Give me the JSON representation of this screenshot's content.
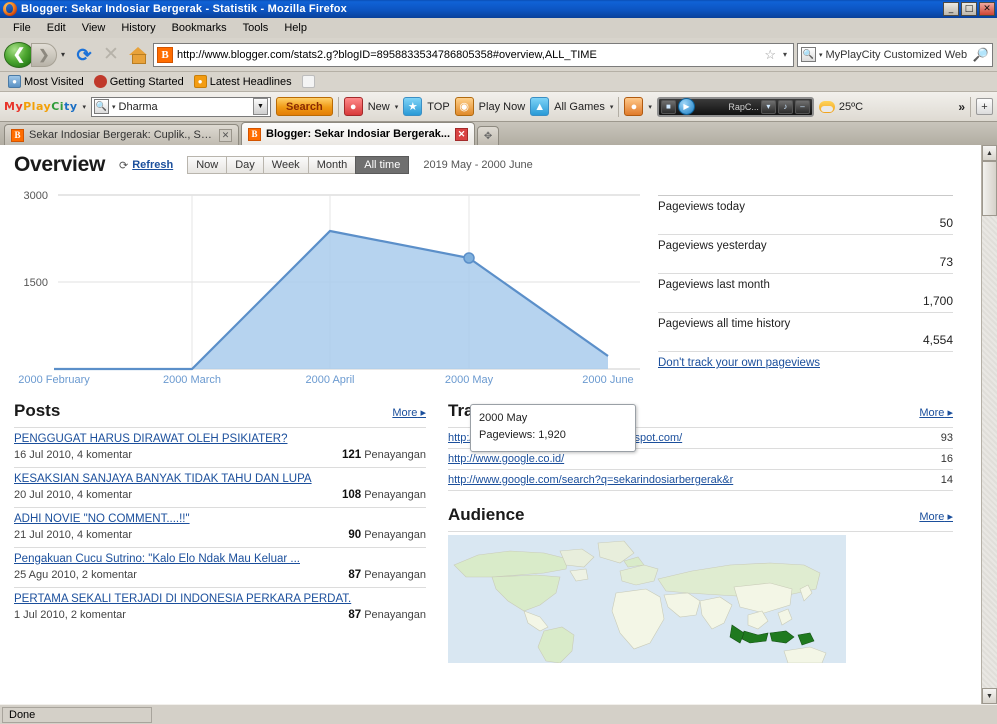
{
  "window": {
    "title": "Blogger: Sekar Indosiar Bergerak - Statistik - Mozilla Firefox",
    "minimize": "_",
    "maximize": "□",
    "close": "✕"
  },
  "menubar": [
    {
      "label": "File"
    },
    {
      "label": "Edit"
    },
    {
      "label": "View"
    },
    {
      "label": "History"
    },
    {
      "label": "Bookmarks"
    },
    {
      "label": "Tools"
    },
    {
      "label": "Help"
    }
  ],
  "navbar": {
    "back": "❮",
    "forward": "❯",
    "history_caret": "▾",
    "reload": "⟳",
    "stop": "✕",
    "url": "http://www.blogger.com/stats2.g?blogID=8958833534786805358#overview,ALL_TIME",
    "favicon_letter": "B",
    "bookmark_star": "☆",
    "url_caret": "▾",
    "search_placeholder": "MyPlayCity Customized Web S",
    "search_caret": "▾"
  },
  "bookmarks": [
    {
      "label": "Most Visited",
      "icon": "compass-icon"
    },
    {
      "label": "Getting Started",
      "icon": "firefox-icon"
    },
    {
      "label": "Latest Headlines",
      "icon": "rss-icon"
    },
    {
      "label": "",
      "icon": "blank-page-icon"
    }
  ],
  "addonbar": {
    "logo": [
      "M",
      "y",
      "P",
      "l",
      "a",
      "y",
      "C",
      "i",
      "t",
      "y"
    ],
    "logo_caret": "▾",
    "search_value": "Dharma",
    "search_button": "Search",
    "items": [
      {
        "label": "New",
        "caret": "▾",
        "icon": "balloon-icon"
      },
      {
        "label": "TOP",
        "caret": "",
        "icon": "star-icon"
      },
      {
        "label": "Play Now",
        "caret": "",
        "icon": "palette-icon"
      },
      {
        "label": "All Games",
        "caret": "▾",
        "icon": "car-icon"
      }
    ],
    "player_track": "RapC...",
    "player_caret": "▾",
    "temperature": "25ºC",
    "overflow": "»",
    "plus": "+"
  },
  "tabs": [
    {
      "label": "Sekar Indosiar Bergerak: Cuplik., Serang...",
      "active": false,
      "close": "✕",
      "favicon": "B"
    },
    {
      "label": "Blogger: Sekar Indosiar Bergerak...",
      "active": true,
      "close": "✕",
      "favicon": "B"
    }
  ],
  "newtab": "✥",
  "stats": {
    "heading": "Overview",
    "refresh_label": "Refresh",
    "refresh_icon": "⟳",
    "range_buttons": [
      {
        "label": "Now",
        "active": false
      },
      {
        "label": "Day",
        "active": false
      },
      {
        "label": "Week",
        "active": false
      },
      {
        "label": "Month",
        "active": false
      },
      {
        "label": "All time",
        "active": true
      }
    ],
    "date_range": "2019 May - 2000 June",
    "tooltip": {
      "period": "2000 May",
      "metric": "Pageviews: 1,920"
    },
    "summary": [
      {
        "label": "Pageviews today",
        "value": "50"
      },
      {
        "label": "Pageviews yesterday",
        "value": "73"
      },
      {
        "label": "Pageviews last month",
        "value": "1,700"
      },
      {
        "label": "Pageviews all time history",
        "value": "4,554"
      }
    ],
    "dont_track_link": "Don't track your own pageviews"
  },
  "chart_data": {
    "type": "area",
    "title": "",
    "xlabel": "",
    "ylabel": "",
    "categories": [
      "2000 February",
      "2000 March",
      "2000 April",
      "2000 May",
      "2000 June"
    ],
    "values": [
      0,
      0,
      2380,
      1920,
      220
    ],
    "series": [
      {
        "name": "Pageviews",
        "values": [
          0,
          0,
          2380,
          1920,
          220
        ]
      }
    ],
    "ylim": [
      0,
      3000
    ],
    "yticks": [
      0,
      1500,
      3000
    ],
    "ytick_labels": [
      "",
      "1500",
      "3000"
    ],
    "grid": true,
    "legend": "none",
    "line_color": "#5b8fc9",
    "fill_color": "#a9cbec",
    "highlight_index": 3,
    "highlight_label": "2000 May",
    "highlight_value": 1920
  },
  "posts": {
    "title": "Posts",
    "more": "More",
    "items": [
      {
        "title": "PENGGUGAT HARUS DIRAWAT OLEH PSIKIATER?",
        "date": "16 Jul 2010, 4 komentar",
        "views": "121",
        "views_label": "Penayangan"
      },
      {
        "title": "KESAKSIAN SANJAYA BANYAK TIDAK TAHU DAN LUPA",
        "date": "20 Jul 2010, 4 komentar",
        "views": "108",
        "views_label": "Penayangan"
      },
      {
        "title": "ADHI NOVIE \"NO COMMENT....!!\"",
        "date": "21 Jul 2010, 4 komentar",
        "views": "90",
        "views_label": "Penayangan"
      },
      {
        "title": "Pengakuan Cucu Sutrino: \"Kalo Elo Ndak Mau Keluar ...",
        "date": "25 Agu 2010, 2 komentar",
        "views": "87",
        "views_label": "Penayangan"
      },
      {
        "title": "PERTAMA SEKALI TERJADI DI INDONESIA PERKARA PERDAT.",
        "date": "1 Jul 2010, 2 komentar",
        "views": "87",
        "views_label": "Penayangan"
      }
    ]
  },
  "traffic": {
    "title": "Traffic Sources",
    "more": "More",
    "items": [
      {
        "url": "http://www.sekarindosiarbergerak.blogspot.com/",
        "count": "93"
      },
      {
        "url": "http://www.google.co.id/",
        "count": "16"
      },
      {
        "url": "http://www.google.com/search?q=sekarindosiarbergerak&r",
        "count": "14"
      }
    ]
  },
  "audience": {
    "title": "Audience",
    "more": "More",
    "map_icon": "world-map",
    "highlight_country": "Indonesia"
  },
  "statusbar": {
    "text": "Done"
  },
  "scrollbar": {
    "up": "▲",
    "down": "▼"
  },
  "colors": {
    "accent": "#1b4f9c",
    "chart_line": "#5b8fc9",
    "chart_fill": "#a9cbec",
    "titlebar": "#0c53bf",
    "map_ocean": "#d9e7f2",
    "map_land": "#f3f6e6",
    "map_highlight": "#1f7a1f"
  }
}
